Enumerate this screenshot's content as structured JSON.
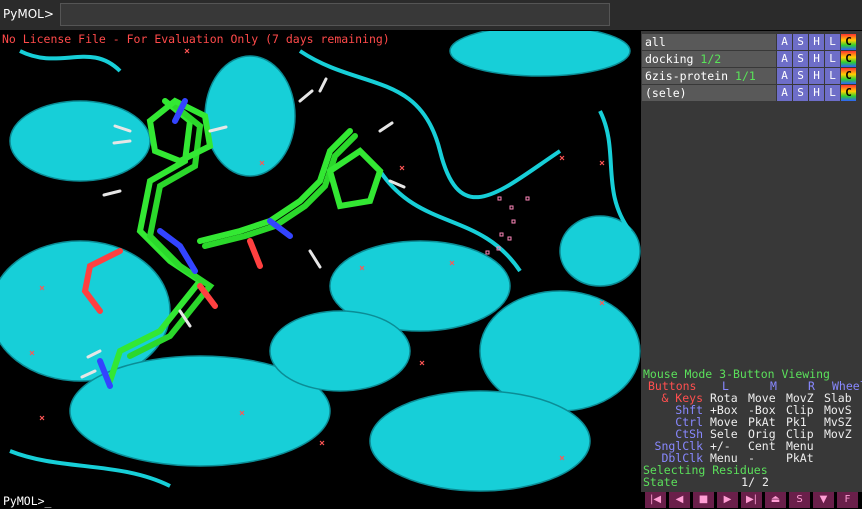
{
  "top": {
    "prompt": "PyMOL>",
    "command_value": ""
  },
  "viewport": {
    "license_text": "No License File - For Evaluation Only (7 days remaining)"
  },
  "objects": [
    {
      "name": "all",
      "frac": "",
      "buttons": [
        "A",
        "S",
        "H",
        "L",
        "C"
      ]
    },
    {
      "name": "docking",
      "frac": "1/2",
      "buttons": [
        "A",
        "S",
        "H",
        "L",
        "C"
      ]
    },
    {
      "name": "6zis-protein",
      "frac": "1/1",
      "buttons": [
        "A",
        "S",
        "H",
        "L",
        "C"
      ]
    },
    {
      "name": "(sele)",
      "frac": "",
      "buttons": [
        "A",
        "S",
        "H",
        "L",
        "C"
      ]
    }
  ],
  "mouse": {
    "title": "Mouse Mode 3-Button Viewing",
    "header": {
      "label": "Buttons",
      "L": "L",
      "M": "M",
      "R": "R",
      "wheel": "Wheel"
    },
    "rows": [
      {
        "mod": "& Keys",
        "L": "Rota",
        "M": "Move",
        "R": "MovZ",
        "W": "Slab"
      },
      {
        "mod": "Shft",
        "L": "+Box",
        "M": "-Box",
        "R": "Clip",
        "W": "MovS"
      },
      {
        "mod": "Ctrl",
        "L": "Move",
        "M": "PkAt",
        "R": "Pk1",
        "W": "MvSZ"
      },
      {
        "mod": "CtSh",
        "L": "Sele",
        "M": "Orig",
        "R": "Clip",
        "W": "MovZ"
      },
      {
        "mod": "SnglClk",
        "L": "+/-",
        "M": "Cent",
        "R": "Menu",
        "W": ""
      },
      {
        "mod": "DblClk",
        "L": "Menu",
        "M": "-",
        "R": "PkAt",
        "W": ""
      }
    ],
    "selecting": "Selecting Residues",
    "state_label": "State",
    "state_value": "1/",
    "state_total": "2"
  },
  "bottom": {
    "prompt": "PyMOL>_"
  },
  "movie_controls": [
    "|◀",
    "◀",
    "■",
    "▶",
    "▶|",
    "⏏",
    "S",
    "▼",
    "F"
  ],
  "colors": {
    "cartoon": "#17cfd8",
    "ligand_carbon": "#33e833",
    "nitrogen": "#3344ff",
    "oxygen": "#ff4040",
    "hydrogen": "#e6e6e6",
    "label_red": "#ff4a4a"
  }
}
